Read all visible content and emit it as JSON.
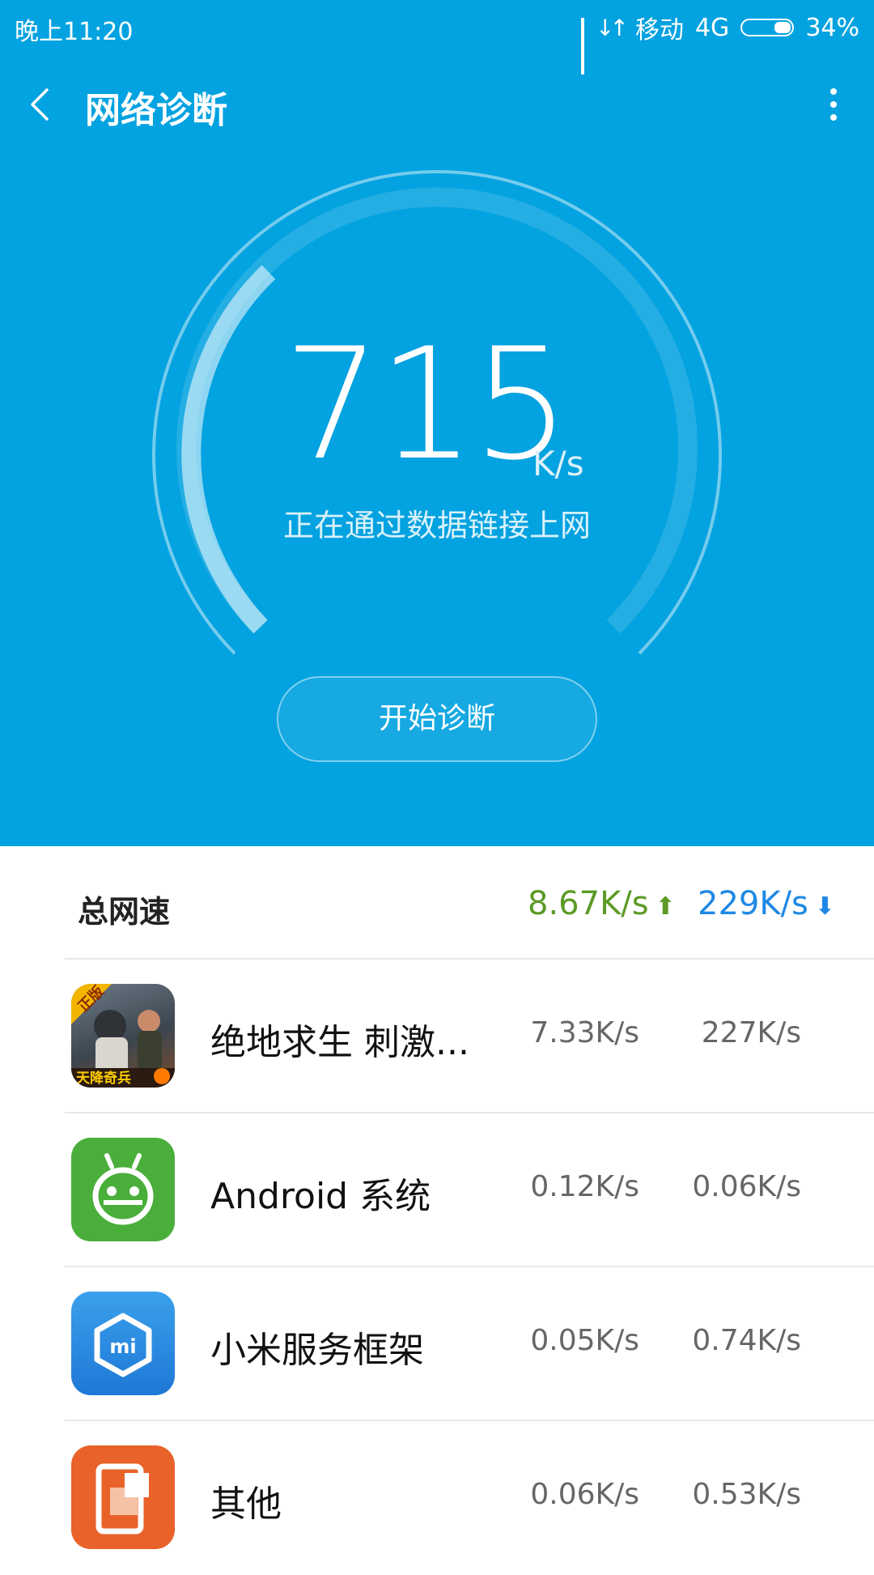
{
  "status_bar": {
    "time": "晚上11:20",
    "carrier": "移动",
    "network": "4G",
    "battery": "34%"
  },
  "app_bar": {
    "title": "网络诊断"
  },
  "gauge": {
    "speed_value": "715",
    "speed_unit": "K/s",
    "status_text": "正在通过数据链接上网",
    "start_button": "开始诊断"
  },
  "total": {
    "label": "总网速",
    "up": "8.67K/s",
    "down": "229K/s"
  },
  "apps": [
    {
      "name": "绝地求生 刺激...",
      "up": "7.33K/s",
      "down": "227K/s",
      "icon": "pubg-game-icon",
      "badge": "正版",
      "banner": "天降奇兵"
    },
    {
      "name": "Android 系统",
      "up": "0.12K/s",
      "down": "0.06K/s",
      "icon": "android-icon"
    },
    {
      "name": "小米服务框架",
      "up": "0.05K/s",
      "down": "0.74K/s",
      "icon": "mi-service-icon",
      "logo_text": "mi"
    },
    {
      "name": "其他",
      "up": "0.06K/s",
      "down": "0.53K/s",
      "icon": "other-apps-icon"
    }
  ],
  "colors": {
    "header_bg": "#03a2e0",
    "up_color": "#5b9a25",
    "down_color": "#1e88e5"
  }
}
